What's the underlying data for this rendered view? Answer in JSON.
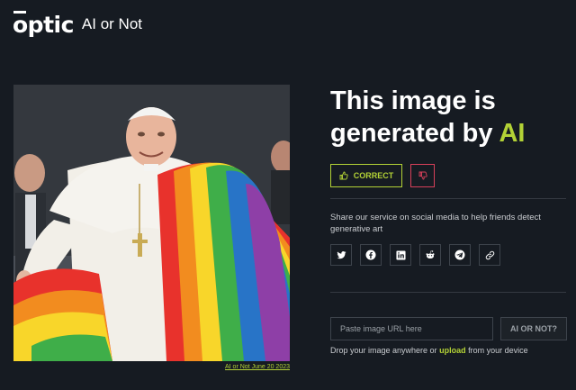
{
  "header": {
    "logo_text": "optic",
    "app_name": "AI or Not"
  },
  "image": {
    "caption": "AI or Not June 20 2023"
  },
  "result": {
    "headline_start": "This image is generated by",
    "headline_accent": "AI"
  },
  "feedback": {
    "correct_label": "CORRECT",
    "correct_icon": "thumbs-up-icon",
    "wrong_icon": "thumbs-down-icon"
  },
  "share": {
    "text": "Share our service on social media to help friends detect generative art",
    "buttons": [
      "twitter-icon",
      "facebook-icon",
      "linkedin-icon",
      "reddit-icon",
      "telegram-icon",
      "link-icon"
    ]
  },
  "check": {
    "placeholder": "Paste image URL here",
    "button_label": "AI OR NOT?",
    "drop_prefix": "Drop your image anywhere or",
    "upload_label": "upload",
    "drop_suffix": "from your device"
  },
  "colors": {
    "background": "#161b22",
    "accent": "#b3d236",
    "danger": "#d7405a",
    "border": "#3d434b"
  }
}
